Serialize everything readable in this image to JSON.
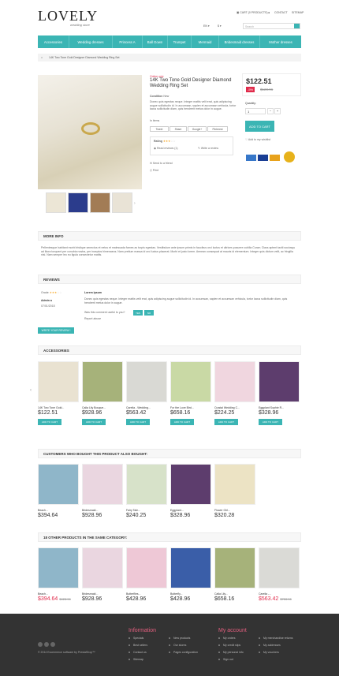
{
  "header": {
    "logo": "LOVELY",
    "tagline": "wedding store",
    "cart": "CART (0 PRODUCTS)",
    "contact": "CONTACT",
    "sitemap": "SITEMAP",
    "lang": "EN",
    "currency": "$",
    "search_placeholder": "Search"
  },
  "nav": [
    "Accessories",
    "Wedding dresses",
    "Princess A",
    "Ball Gown",
    "Trumpet",
    "Mermaid",
    "Bridesmaid dresses",
    "Mother dresses"
  ],
  "breadcrumb": "14K Two Tone Gold Designer Diamond Wedding Ring Set",
  "product": {
    "badge": "Online only",
    "title": "14K Two Tone Gold Designer Diamond Wedding Ring Set",
    "condition_label": "Condition",
    "condition": "New",
    "desc": "Donec quis egestas neque. Integer mattis velit erat, quis adipiscing augue sollicitudin id. In accumsan, sapien et accumsan vehicula, tortor lacus sollicitudin diam, quis hendrerit metus dolor in augue.",
    "in_items": "In items",
    "share": [
      "Tweet",
      "Share",
      "Google+",
      "Pinterest"
    ],
    "rating_label": "Rating",
    "read_reviews": "Read reviews (1)",
    "write_review": "Write a review",
    "send_friend": "Send to a friend",
    "print": "Print",
    "price": "$122.51",
    "discount": "-5%",
    "old_price": "$128.96",
    "quantity_label": "Quantity:",
    "quantity": "1",
    "add_to_cart": "ADD TO CART",
    "wishlist": "Add to my wishlist"
  },
  "more_info": {
    "title": "MORE INFO",
    "text": "Pellentesque habitant morbi tristique senectus et netus et malesuada fames ac turpis egestas. Vestibulum ante ipsum primis in faucibus orci luctus et ultrices posuere cubilia Curae; Class aptent taciti sociosqu ad litora torquent per conubia nostra, per inceptos himenaeos. Nam pretium massa id orci luctus placerat. Morbi et justo lorem. Aenean consequat at mauris id elementum. Integer quis dictum velit, ac fringilla nisi. Nam semper leo eu ligula consectetur mattis."
  },
  "reviews": {
    "title": "REVIEWS",
    "grade_label": "Grade",
    "author": "Admin a",
    "date": "07/01/2018",
    "review_title": "Lorem ipsum",
    "review_text": "Donec quis egestas neque. Integer mattis velit erat, quis adipiscing augue sollicitudin id. In accumsan, sapien et accumsan vehicula, tortor lacus sollicitudin diam, quis hendrerit metus dolor in augue.",
    "useful": "Was this comment useful to you?",
    "yes": "YES",
    "no": "NO",
    "report": "Report abuse",
    "write": "WRITE YOUR REVIEW !"
  },
  "accessories": {
    "title": "ACCESSORIES",
    "items": [
      {
        "name": "14K Two Tone Gold...",
        "price": "$122.51"
      },
      {
        "name": "Calla Lily Bouque...",
        "price": "$928.96"
      },
      {
        "name": "Carelia - Wedding...",
        "price": "$563.42"
      },
      {
        "name": "For the Love Bird...",
        "price": "$658.16"
      },
      {
        "name": "Crystal Wedding C...",
        "price": "$224.25"
      },
      {
        "name": "Eggplant Sophie R...",
        "price": "$328.96"
      }
    ],
    "btn": "ADD TO CART"
  },
  "bought": {
    "title": "CUSTOMERS WHO BOUGHT THIS PRODUCT ALSO BOUGHT:",
    "items": [
      {
        "name": "Beach...",
        "price": "$394.64"
      },
      {
        "name": "Bridesmaid...",
        "price": "$928.96"
      },
      {
        "name": "Fairy Tale...",
        "price": "$240.25"
      },
      {
        "name": "Eggplant...",
        "price": "$328.96"
      },
      {
        "name": "Flower Girl...",
        "price": "$320.28"
      }
    ]
  },
  "same": {
    "title": "18 OTHER PRODUCTS IN THE SAME CATEGORY:",
    "items": [
      {
        "name": "Beach...",
        "price": "$394.64",
        "old": "$428.96"
      },
      {
        "name": "Bridesmaid...",
        "price": "$928.96",
        "old": ""
      },
      {
        "name": "Butterflies...",
        "price": "$428.96",
        "old": ""
      },
      {
        "name": "Butterfly...",
        "price": "$428.96",
        "old": ""
      },
      {
        "name": "Calla Lily...",
        "price": "$658.16",
        "old": ""
      },
      {
        "name": "Carelia -...",
        "price": "$563.42",
        "old": "$728.96"
      }
    ]
  },
  "footer": {
    "copy": "© 2014 Ecommerce software by PrestaShop™",
    "info_title": "Information",
    "col1": [
      "Specials",
      "Best sellers",
      "Contact us",
      "Sitemap"
    ],
    "col2": [
      "New products",
      "Our stores",
      "Pages configuration"
    ],
    "account_title": "My account",
    "col3": [
      "My orders",
      "My credit slips",
      "My personal info",
      "Sign out"
    ],
    "col4": [
      "My merchandise returns",
      "My addresses",
      "My vouchers"
    ]
  }
}
